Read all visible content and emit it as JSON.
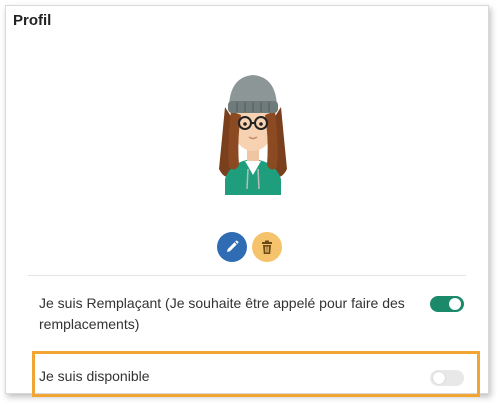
{
  "profile": {
    "title": "Profil"
  },
  "actions": {
    "edit_icon": "pencil-icon",
    "delete_icon": "trash-icon"
  },
  "settings": {
    "remplacant_label": "Je suis Remplaçant (Je souhaite être appelé pour faire des remplacements)",
    "remplacant_on": true,
    "disponible_label": "Je suis disponible",
    "disponible_on": false
  },
  "colors": {
    "toggle_on": "#1a8a6b",
    "toggle_off": "#e8e8e8",
    "highlight": "#f1a532",
    "edit_button": "#2f6cb3",
    "delete_button": "#f4c36b"
  }
}
